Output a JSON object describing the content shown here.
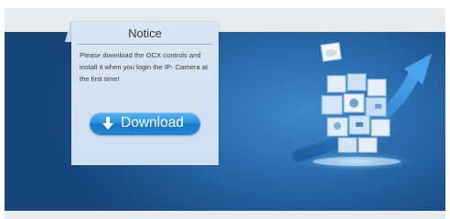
{
  "notice": {
    "title": "Notice",
    "message": "Please download the OCX controls and install it when you login the IP- Camera at the first time!"
  },
  "download": {
    "label": "Download",
    "icon": "download-arrow-icon"
  },
  "illustration": {
    "name": "camera-cube-graphic"
  },
  "colors": {
    "banner": "#2a6dae",
    "panel": "#d9e5f3",
    "button": "#2a8fdc",
    "button_text": "#ffffff",
    "band": "#e9ecef"
  }
}
